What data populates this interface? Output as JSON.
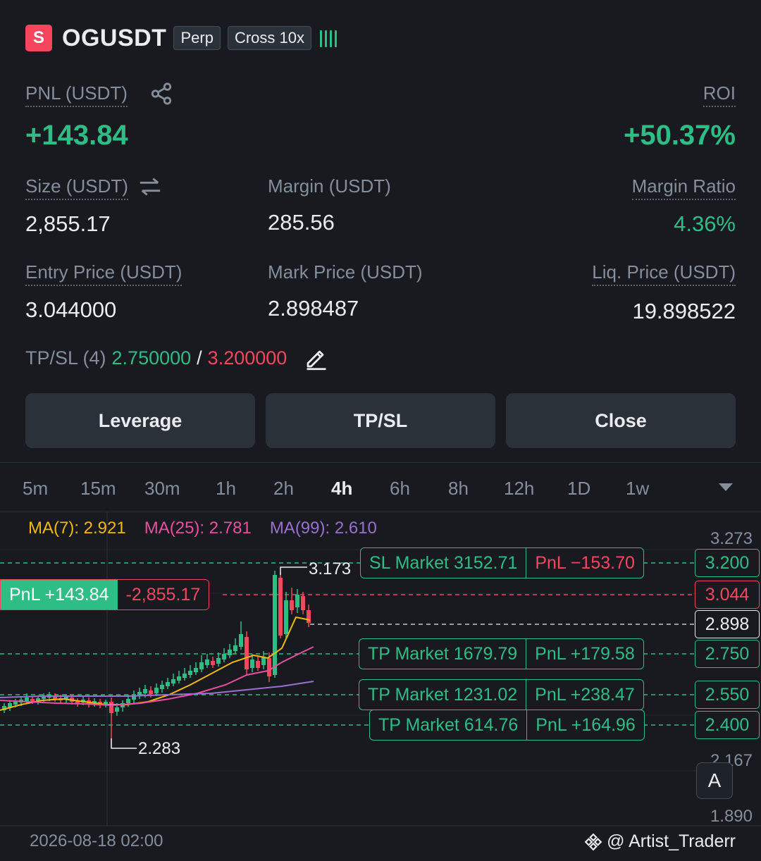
{
  "header": {
    "side_badge": "S",
    "symbol": "OGUSDT",
    "tag_type": "Perp",
    "tag_margin": "Cross 10x",
    "signal_icon": "signal-bars-icon"
  },
  "position": {
    "pnl_label": "PNL (USDT)",
    "pnl_value": "+143.84",
    "roi_label": "ROI",
    "roi_value": "+50.37%",
    "size_label": "Size (USDT)",
    "size_value": "2,855.17",
    "margin_label": "Margin (USDT)",
    "margin_value": "285.56",
    "margin_ratio_label": "Margin Ratio",
    "margin_ratio_value": "4.36%",
    "entry_label": "Entry Price (USDT)",
    "entry_value": "3.044000",
    "mark_label": "Mark Price (USDT)",
    "mark_value": "2.898487",
    "liq_label": "Liq. Price (USDT)",
    "liq_value": "19.898522",
    "tpsl_label": "TP/SL (4)",
    "tp_value": "2.750000",
    "tpsl_sep": "/",
    "sl_value": "3.200000"
  },
  "buttons": {
    "leverage": "Leverage",
    "tpsl": "TP/SL",
    "close": "Close"
  },
  "intervals": [
    "5m",
    "15m",
    "30m",
    "1h",
    "2h",
    "4h",
    "6h",
    "8h",
    "12h",
    "1D",
    "1w"
  ],
  "active_interval": "4h",
  "chart": {
    "ma7": "MA(7): 2.921",
    "ma25": "MA(25): 2.781",
    "ma99": "MA(99): 2.610",
    "axis": [
      "3.273",
      "2.167",
      "1.890"
    ],
    "high_label": "3.173",
    "low_label": "2.283",
    "date_label": "2026-08-18 02:00",
    "watermark": "@ Artist_Traderr",
    "auto_label": "A",
    "lines": {
      "sl": {
        "price": "3.200",
        "type": "SL Market 3152.71",
        "pnl": "PnL −153.70"
      },
      "entry": {
        "price": "3.044",
        "pnl": "PnL +143.84",
        "size": "-2,855.17"
      },
      "mark": {
        "price": "2.898"
      },
      "tp1": {
        "price": "2.750",
        "type": "TP Market 1679.79",
        "pnl": "PnL +179.58"
      },
      "tp2": {
        "price": "2.550",
        "type": "TP Market 1231.02",
        "pnl": "PnL +238.47"
      },
      "tp3": {
        "price": "2.400",
        "type": "TP Market 614.76",
        "pnl": "PnL +164.96"
      }
    }
  },
  "colors": {
    "green": "#2ebd85",
    "red": "#f6465d",
    "background": "#181a20",
    "ma7": "#f0b90b",
    "ma25": "#e84fa1",
    "ma99": "#9b6fd1"
  }
}
